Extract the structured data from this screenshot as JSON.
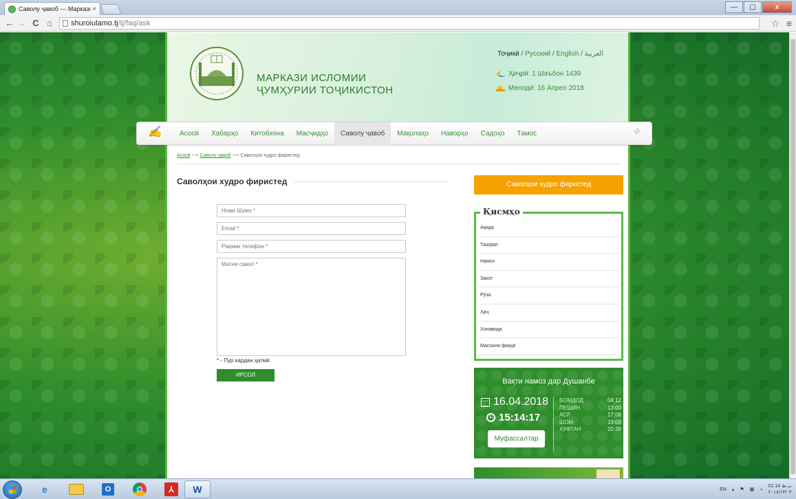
{
  "browser": {
    "tab_title": "Саволу ҷавоб — Маркази",
    "tab_close": "×",
    "url_host": "shuroiulamo.tj",
    "url_path": "/tj/faq/ask",
    "back": "←",
    "forward": "→",
    "reload": "C",
    "home": "⌂",
    "star": "☆",
    "menu": "≡",
    "window_minimize": "—",
    "window_maximize": "▢",
    "window_close": "x"
  },
  "header": {
    "title_line1": "МАРКАЗИ ИСЛОМИИ",
    "title_line2": "ҶУМҲУРИИ ТОҶИКИСТОН",
    "languages": {
      "current": "Тоҷикӣ",
      "others": [
        "Русский",
        "English",
        "العربية"
      ],
      "separator": " / "
    },
    "hijri_date": "Ҳиҷрӣ: 1 Шаъбон 1439",
    "gregorian_date": "Мелодӣ: 16 Апрел 2018"
  },
  "nav": {
    "items": [
      {
        "label": "Асосӣ"
      },
      {
        "label": "Хабарҳо"
      },
      {
        "label": "Китобхона"
      },
      {
        "label": "Масҷидҳо"
      },
      {
        "label": "Саволу ҷавоб"
      },
      {
        "label": "Мақолаҳо"
      },
      {
        "label": "Наворҳо"
      },
      {
        "label": "Садоҳо"
      },
      {
        "label": "Тамос"
      }
    ],
    "active_index": 4
  },
  "breadcrumb": {
    "home": "Асосӣ",
    "section": "Саволу ҷавоб",
    "current": "Саволҳои худро фиристед",
    "arrow": "⟶"
  },
  "form": {
    "heading": "Саволҳои худро фиристед",
    "name_placeholder": "Номи Шумо *",
    "email_placeholder": "Email *",
    "phone_placeholder": "Рақами телефон *",
    "message_placeholder": "Матни савол *",
    "required_note": "* - Пур кардан ҳатмӣ.",
    "submit_label": "ИРСОЛ"
  },
  "sidebar": {
    "ask_button": "Саволҳои худро фиристед",
    "categories_title": "Қисмҳо",
    "categories": [
      "Ақида",
      "Таҳорат",
      "Намоз",
      "Закот",
      "Рӯза",
      "Ҳаҷ",
      "Хонавода",
      "Масоили фиқҳӣ"
    ]
  },
  "prayer": {
    "heading": "Вақти намоз дар Душанбе",
    "date": "16.04.2018",
    "time": "15:14:17",
    "details_button": "Муфассалтар",
    "times": [
      {
        "name": "БОМДОД",
        "time": "04:12"
      },
      {
        "name": "ПЕШИН",
        "time": "13:00"
      },
      {
        "name": "АСР",
        "time": "17:08"
      },
      {
        "name": "ШОМ",
        "time": "19:09"
      },
      {
        "name": "ХУФТАН",
        "time": "20:39"
      }
    ]
  },
  "taskbar": {
    "language": "EN",
    "clock_time": "01:14 ب.ظ",
    "clock_date": "۲۰۱۸/۱۴/۰۴",
    "apps": [
      "internet-explorer",
      "file-explorer",
      "outlook",
      "chrome",
      "acrobat",
      "word"
    ]
  }
}
